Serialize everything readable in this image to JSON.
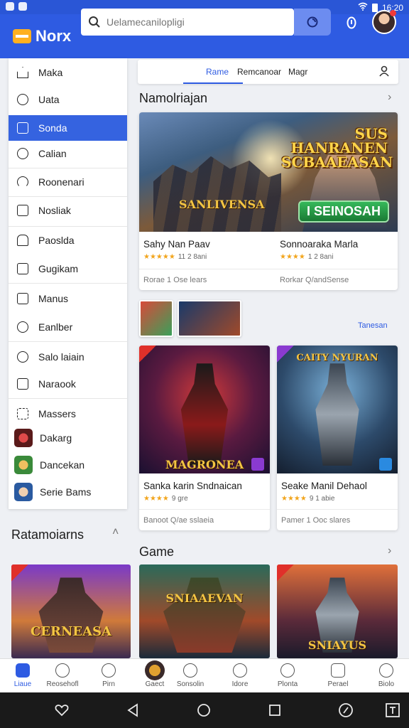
{
  "status_bar": {
    "time": "16:20"
  },
  "header": {
    "app_name": "Norx",
    "search_placeholder": "Uelamecanilopligi"
  },
  "sidebar": {
    "items": [
      {
        "label": "Maka",
        "icon": "home-icon"
      },
      {
        "label": "Uata",
        "icon": "search-icon"
      },
      {
        "label": "Sonda",
        "icon": "folder-icon",
        "active": true
      },
      {
        "label": "Calian",
        "icon": "clock-icon"
      },
      {
        "label": "Roonenari",
        "icon": "wifi-icon"
      },
      {
        "label": "Nosliak",
        "icon": "square-icon"
      },
      {
        "label": "Paoslda",
        "icon": "bag-icon"
      },
      {
        "label": "Gugikam",
        "icon": "gamepad-icon"
      },
      {
        "label": "Manus",
        "icon": "inbox-icon"
      },
      {
        "label": "Eanlber",
        "icon": "user-icon"
      },
      {
        "label": "Salo laiain",
        "icon": "compass-icon"
      },
      {
        "label": "Naraook",
        "icon": "book-icon"
      },
      {
        "label": "Massers",
        "icon": "grid-icon"
      },
      {
        "label": "Dakarg",
        "icon": "game-thumb"
      },
      {
        "label": "Dancekan",
        "icon": "game-thumb"
      },
      {
        "label": "Serie Bams",
        "icon": "game-thumb"
      }
    ]
  },
  "tabs": [
    {
      "label": "Rame",
      "active": true
    },
    {
      "label": "Remcanoar"
    },
    {
      "label": "Magr"
    }
  ],
  "sections": {
    "featured_title": "Namolriajan",
    "left_title": "Ratamoiarns",
    "game_title": "Game",
    "see_more_link": "Tanesan"
  },
  "featured": {
    "banner_title": "SUS HANRANEN SCBAAEASAN",
    "banner_logo": "SANLIVENSA",
    "banner_badge": "I SEINOSAH",
    "cards": [
      {
        "name": "Sahy Nan Paav",
        "stars": "★★★★★",
        "rating": "11 2 8ani",
        "meta": "Rorae 1 Ose lears"
      },
      {
        "name": "Sonnoaraka Marla",
        "stars": "★★★★",
        "rating": "1 2 8ani",
        "meta": "Rorkar Q/andSense"
      }
    ]
  },
  "games": [
    {
      "name": "Sanka karin Sndnaican",
      "stars": "★★★★",
      "rating": "9 gre",
      "meta": "Banoot Q/ae sslaeia",
      "art_title": "MAGRONEA"
    },
    {
      "name": "Seake Manil Dehaol",
      "stars": "★★★★",
      "rating": "9 1 abie",
      "meta": "Pamer 1 Ooc slares",
      "art_title": "CAITY NYURAN"
    }
  ],
  "bottom_cards": [
    {
      "art_title": "CERNEASA"
    },
    {
      "art_title": "SNIAAEVAN"
    },
    {
      "art_title": "SNIAYUS"
    }
  ],
  "bottom_nav": [
    {
      "label": "Liaue",
      "active": true
    },
    {
      "label": "Reosehofl"
    },
    {
      "label": "Pirn"
    },
    {
      "label": "Gaect"
    },
    {
      "label": "Sonsolin"
    },
    {
      "label": "Idore"
    },
    {
      "label": "Plonta"
    },
    {
      "label": "Perael"
    },
    {
      "label": "Biolo"
    }
  ],
  "colors": {
    "brand_blue": "#2e5be2",
    "active_blue": "#3563e0",
    "star": "#f2a51d"
  }
}
